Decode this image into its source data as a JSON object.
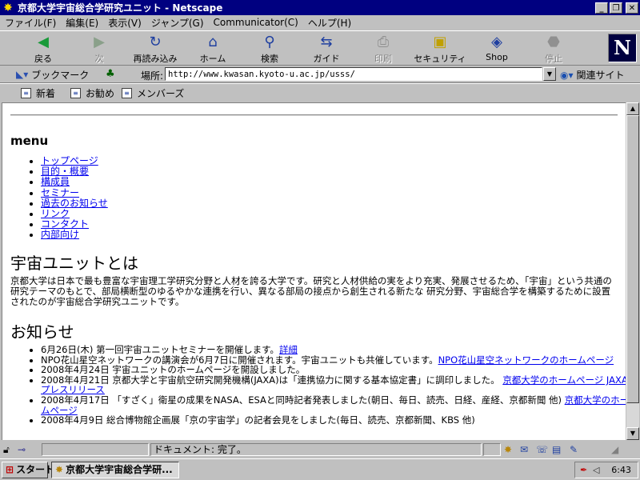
{
  "window": {
    "title": "京都大学宇宙総合学研究ユニット - Netscape",
    "buttons": [
      "_",
      "❐",
      "✕"
    ]
  },
  "menubar": [
    "ファイル(F)",
    "編集(E)",
    "表示(V)",
    "ジャンプ(G)",
    "Communicator(C)",
    "ヘルプ(H)"
  ],
  "toolbar": [
    {
      "label": "戻る",
      "icon": "back-arrow-icon",
      "glyph": "◀",
      "color": "#1a9a3a",
      "enabled": true
    },
    {
      "label": "次",
      "icon": "forward-arrow-icon",
      "glyph": "▶",
      "color": "#8aa08a",
      "enabled": false
    },
    {
      "label": "再読み込み",
      "icon": "reload-icon",
      "glyph": "↻",
      "color": "#1f3fa0",
      "enabled": true
    },
    {
      "label": "ホーム",
      "icon": "home-icon",
      "glyph": "⌂",
      "color": "#1f3fa0",
      "enabled": true
    },
    {
      "label": "検索",
      "icon": "search-icon",
      "glyph": "🔍︎",
      "color": "#1f3fa0",
      "enabled": true
    },
    {
      "label": "ガイド",
      "icon": "guide-signpost-icon",
      "glyph": "⇆",
      "color": "#1f3fa0",
      "enabled": true
    },
    {
      "label": "印刷",
      "icon": "print-icon",
      "glyph": "⎙",
      "color": "#909090",
      "enabled": false
    },
    {
      "label": "セキュリティ",
      "icon": "security-lock-icon",
      "glyph": "🔒︎",
      "color": "#c0a000",
      "enabled": true
    },
    {
      "label": "Shop",
      "icon": "shop-bag-icon",
      "glyph": "◈",
      "color": "#1f3fa0",
      "enabled": true
    },
    {
      "label": "停止",
      "icon": "stop-icon",
      "glyph": "⬣",
      "color": "#909090",
      "enabled": false
    }
  ],
  "logo": "N",
  "locationbar": {
    "bookmarks_label": "ブックマーク",
    "location_label": "場所:",
    "url": "http://www.kwasan.kyoto-u.ac.jp/usss/",
    "related_label": "関連サイト"
  },
  "personalbar": [
    "新着",
    "お勧め",
    "メンバーズ"
  ],
  "page": {
    "menu_heading": "menu",
    "menu_links": [
      "トップページ",
      "目的・概要",
      "構成員",
      "セミナー",
      "過去のお知らせ",
      "リンク",
      "コンタクト",
      "内部向け"
    ],
    "about_heading": "宇宙ユニットとは",
    "about_text": "京都大学は日本で最も豊富な宇宙理工学研究分野と人材を誇る大学です。研究と人材供給の実をより充実、発展させるため、「宇宙」という共通の研究テーマのもとで、部局横断型のゆるやかな連携を行い、異なる部局の接点から創生される新たな 研究分野、宇宙総合学を構築するために設置されたのが宇宙総合学研究ユニットです。",
    "news_heading": "お知らせ",
    "news": [
      {
        "text": "6月26日(木) 第一回宇宙ユニットセミナーを開催します。",
        "link": "詳細"
      },
      {
        "text": "NPO花山星空ネットワークの講演会が6月7日に開催されます。宇宙ユニットも共催しています。",
        "link": "NPO花山星空ネットワークのホームページ"
      },
      {
        "text": "2008年4月24日 宇宙ユニットのホームページを開設しました。",
        "link": ""
      },
      {
        "text": "2008年4月21日 京都大学と宇宙航空研究開発機構(JAXA)は「連携協力に関する基本協定書」に調印しました。",
        "link": "京都大学のホームページ JAXAプレスリリース"
      },
      {
        "text": "2008年4月17日 「すざく」衛星の成果をNASA、ESAと同時記者発表しました(朝日、毎日、読売、日経、産経、京都新聞 他)",
        "link": "京都大学のホームページ"
      },
      {
        "text": "2008年4月9日 総合博物館企画展「京の宇宙学」の記者会見をしました(毎日、読売、京都新聞、KBS 他)",
        "link": ""
      }
    ]
  },
  "statusbar": {
    "text": "ドキュメント: 完了。"
  },
  "taskbar": {
    "start_label": "スタート",
    "task_label": "京都大学宇宙総合学研...",
    "clock": "6:43"
  }
}
